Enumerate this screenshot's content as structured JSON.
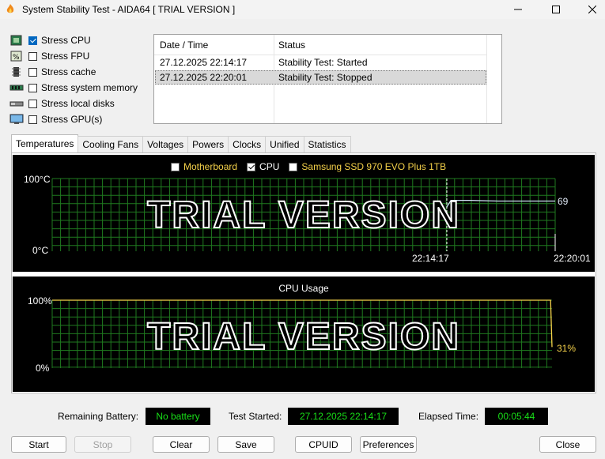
{
  "window": {
    "title": "System Stability Test - AIDA64  [ TRIAL VERSION ]",
    "minimize_icon": "minimize-icon",
    "maximize_icon": "maximize-icon",
    "close_icon": "close-icon"
  },
  "stress": [
    {
      "label": "Stress CPU",
      "checked": true,
      "icon": "cpu-icon"
    },
    {
      "label": "Stress FPU",
      "checked": false,
      "icon": "fpu-icon"
    },
    {
      "label": "Stress cache",
      "checked": false,
      "icon": "cache-icon"
    },
    {
      "label": "Stress system memory",
      "checked": false,
      "icon": "memory-icon"
    },
    {
      "label": "Stress local disks",
      "checked": false,
      "icon": "disk-icon"
    },
    {
      "label": "Stress GPU(s)",
      "checked": false,
      "icon": "gpu-icon"
    }
  ],
  "log": {
    "columns": [
      "Date / Time",
      "Status"
    ],
    "rows": [
      [
        "27.12.2025 22:14:17",
        "Stability Test: Started"
      ],
      [
        "27.12.2025 22:20:01",
        "Stability Test: Stopped"
      ]
    ]
  },
  "tabs": [
    "Temperatures",
    "Cooling Fans",
    "Voltages",
    "Powers",
    "Clocks",
    "Unified",
    "Statistics"
  ],
  "active_tab": "Temperatures",
  "temp_chart": {
    "legend": [
      {
        "label": "Motherboard",
        "checked": false
      },
      {
        "label": "CPU",
        "checked": true
      },
      {
        "label": "Samsung SSD 970 EVO Plus 1TB",
        "checked": false
      }
    ],
    "y_top": "100°C",
    "y_bottom": "0°C",
    "x_start_label": "22:14:17",
    "x_end_label": "22:20:01",
    "current_value_label": "69",
    "watermark": "TRIAL VERSION"
  },
  "cpu_chart": {
    "title": "CPU Usage",
    "y_top": "100%",
    "y_bottom": "0%",
    "current_value_label": "31%",
    "watermark": "TRIAL VERSION"
  },
  "status": {
    "battery_label": "Remaining Battery:",
    "battery_value": "No battery",
    "started_label": "Test Started:",
    "started_value": "27.12.2025 22:14:17",
    "elapsed_label": "Elapsed Time:",
    "elapsed_value": "00:05:44"
  },
  "buttons": {
    "start": "Start",
    "stop": "Stop",
    "clear": "Clear",
    "save": "Save",
    "cpuid": "CPUID",
    "preferences": "Preferences",
    "close": "Close"
  },
  "chart_data": [
    {
      "type": "line",
      "title": "",
      "ylim": [
        0,
        100
      ],
      "ylabel": "°C",
      "series": [
        {
          "name": "CPU",
          "x": [
            "22:14:17",
            "22:14:30",
            "22:15:30",
            "22:17:00",
            "22:18:30",
            "22:20:01"
          ],
          "values": [
            61,
            70,
            70,
            69,
            69,
            69
          ]
        }
      ],
      "grid": true,
      "legend": "top-center"
    },
    {
      "type": "line",
      "title": "CPU Usage",
      "ylim": [
        0,
        100
      ],
      "series": [
        {
          "name": "",
          "x": [
            "22:14:17",
            "22:20:00",
            "22:20:01"
          ],
          "values": [
            100,
            100,
            31
          ]
        }
      ],
      "grid": true
    }
  ]
}
